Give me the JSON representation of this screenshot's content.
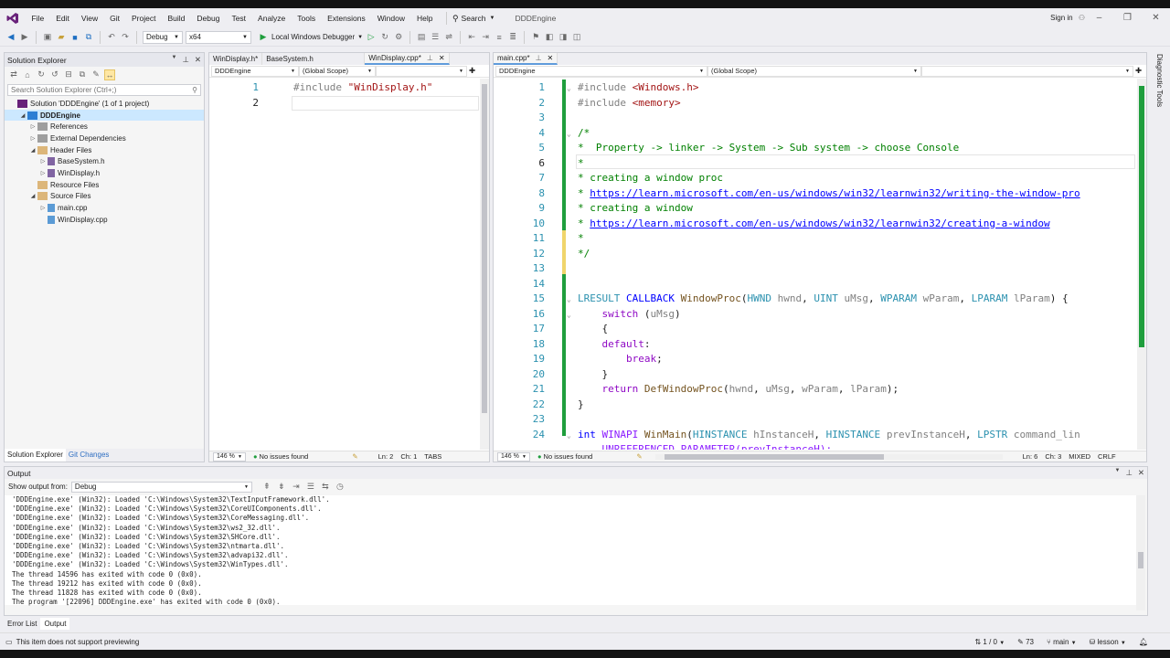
{
  "menu": [
    "File",
    "Edit",
    "View",
    "Git",
    "Project",
    "Build",
    "Debug",
    "Test",
    "Analyze",
    "Tools",
    "Extensions",
    "Window",
    "Help"
  ],
  "search_label": "Search",
  "solution_name": "DDDEngine",
  "sign_in": "Sign in",
  "toolbar": {
    "config": "Debug",
    "platform": "x64",
    "debugger": "Local Windows Debugger"
  },
  "solution_explorer": {
    "title": "Solution Explorer",
    "search_placeholder": "Search Solution Explorer (Ctrl+;)",
    "items": [
      {
        "label": "Solution 'DDDEngine' (1 of 1 project)",
        "indent": 0,
        "arrow": ""
      },
      {
        "label": "DDDEngine",
        "indent": 1,
        "arrow": "◢",
        "bold": true,
        "selected": true
      },
      {
        "label": "References",
        "indent": 2,
        "arrow": "▷"
      },
      {
        "label": "External Dependencies",
        "indent": 2,
        "arrow": "▷"
      },
      {
        "label": "Header Files",
        "indent": 2,
        "arrow": "◢"
      },
      {
        "label": "BaseSystem.h",
        "indent": 3,
        "arrow": "▷"
      },
      {
        "label": "WinDisplay.h",
        "indent": 3,
        "arrow": "▷"
      },
      {
        "label": "Resource Files",
        "indent": 2,
        "arrow": ""
      },
      {
        "label": "Source Files",
        "indent": 2,
        "arrow": "◢"
      },
      {
        "label": "main.cpp",
        "indent": 3,
        "arrow": "▷"
      },
      {
        "label": "WinDisplay.cpp",
        "indent": 3,
        "arrow": ""
      }
    ],
    "tabs": [
      "Solution Explorer",
      "Git Changes"
    ]
  },
  "left_editor": {
    "tabs": [
      "WinDisplay.h*",
      "BaseSystem.h",
      "WinDisplay.cpp*"
    ],
    "project_combo": "DDDEngine",
    "scope_combo": "(Global Scope)",
    "line_numbers": [
      "1",
      "2"
    ],
    "line1_pre": "#include ",
    "line1_str": "\"WinDisplay.h\"",
    "zoom": "146 %",
    "issues": "No issues found",
    "ln": "Ln: 2",
    "ch": "Ch: 1",
    "tabs_mode": "TABS"
  },
  "right_editor": {
    "tab": "main.cpp*",
    "project_combo": "DDDEngine",
    "scope_combo": "(Global Scope)",
    "line_numbers": [
      "1",
      "2",
      "3",
      "4",
      "5",
      "6",
      "7",
      "8",
      "9",
      "10",
      "11",
      "12",
      "13",
      "14",
      "15",
      "16",
      "17",
      "18",
      "19",
      "20",
      "21",
      "22",
      "23",
      "24"
    ],
    "code": {
      "l1a": "#include ",
      "l1b": "<Windows.h>",
      "l2a": "#include ",
      "l2b": "<memory>",
      "l4": "/*",
      "l5": "*  Property -> linker -> System -> Sub system -> choose Console",
      "l6": "*",
      "l7": "* creating a window proc",
      "l8a": "* ",
      "l8b": "https://learn.microsoft.com/en-us/windows/win32/learnwin32/writing-the-window-pro",
      "l9": "* creating a window",
      "l10a": "* ",
      "l10b": "https://learn.microsoft.com/en-us/windows/win32/learnwin32/creating-a-window",
      "l11": "*",
      "l12": "*/",
      "l15_t": "LRESULT",
      "l15_cb": "CALLBACK",
      "l15_fn": "WindowProc",
      "l15_a1t": "HWND",
      "l15_a1": "hwnd",
      "l15_a2t": "UINT",
      "l15_a2": "uMsg",
      "l15_a3t": "WPARAM",
      "l15_a3": "wParam",
      "l15_a4t": "LPARAM",
      "l15_a4": "lParam",
      "l16_kw": "switch",
      "l16_p": "uMsg",
      "l18_kw": "default",
      "l19_kw": "break",
      "l21_kw": "return",
      "l21_fn": "DefWindowProc",
      "l21_a1": "hwnd",
      "l21_a2": "uMsg",
      "l21_a3": "wParam",
      "l21_a4": "lParam",
      "l24_kw": "int",
      "l24_cc": "WINAPI",
      "l24_fn": "WinMain",
      "l24_a1t": "HINSTANCE",
      "l24_a1": "hInstanceH",
      "l24_a2t": "HINSTANCE",
      "l24_a2": "prevInstanceH",
      "l24_a3t": "LPSTR",
      "l24_a3": "command_lin",
      "l25": "UNREFERENCED_PARAMETER(prevInstanceH);"
    },
    "zoom": "146 %",
    "issues": "No issues found",
    "ln": "Ln: 6",
    "ch": "Ch: 3",
    "eol_mode": "MIXED",
    "eol": "CRLF"
  },
  "output": {
    "title": "Output",
    "show_from_label": "Show output from:",
    "source": "Debug",
    "lines": [
      "'DDDEngine.exe' (Win32): Loaded 'C:\\Windows\\System32\\TextInputFramework.dll'.",
      "'DDDEngine.exe' (Win32): Loaded 'C:\\Windows\\System32\\CoreUIComponents.dll'.",
      "'DDDEngine.exe' (Win32): Loaded 'C:\\Windows\\System32\\CoreMessaging.dll'.",
      "'DDDEngine.exe' (Win32): Loaded 'C:\\Windows\\System32\\ws2_32.dll'.",
      "'DDDEngine.exe' (Win32): Loaded 'C:\\Windows\\System32\\SHCore.dll'.",
      "'DDDEngine.exe' (Win32): Loaded 'C:\\Windows\\System32\\ntmarta.dll'.",
      "'DDDEngine.exe' (Win32): Loaded 'C:\\Windows\\System32\\advapi32.dll'.",
      "'DDDEngine.exe' (Win32): Loaded 'C:\\Windows\\System32\\WinTypes.dll'.",
      "The thread 14596 has exited with code 0 (0x0).",
      "The thread 19212 has exited with code 0 (0x0).",
      "The thread 11828 has exited with code 0 (0x0).",
      "The program '[22096] DDDEngine.exe' has exited with code 0 (0x0)."
    ]
  },
  "bottom_tabs": [
    "Error List",
    "Output"
  ],
  "statusbar": {
    "message": "This item does not support previewing",
    "lines_changed": "1 / 0",
    "edits": "73",
    "branch": "main",
    "repo": "lesson"
  },
  "side_tab": "Diagnostic Tools"
}
